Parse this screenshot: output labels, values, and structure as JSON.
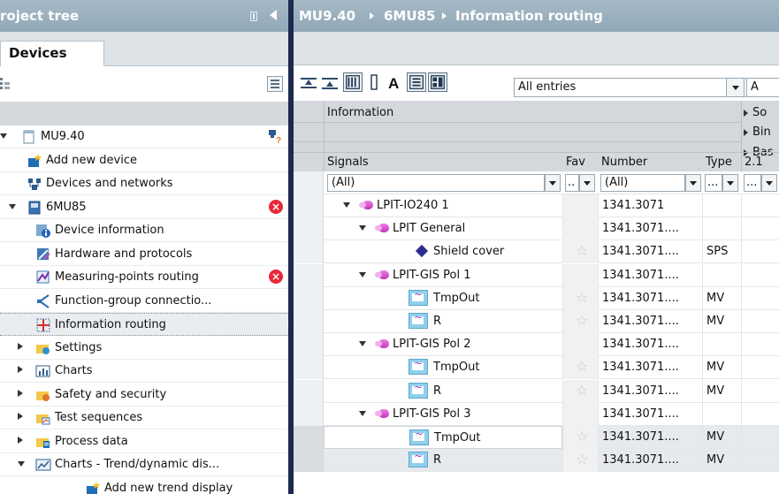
{
  "left_pane": {
    "title": "roject tree",
    "tab": "Devices",
    "tree": [
      {
        "label": "MU9.40",
        "indent": 0,
        "expand": "down",
        "icon": "page-icon",
        "right": "online"
      },
      {
        "label": "Add new device",
        "indent": 1,
        "expand": "none",
        "icon": "add-device-icon"
      },
      {
        "label": "Devices and networks",
        "indent": 1,
        "expand": "none",
        "icon": "network-icon"
      },
      {
        "label": "6MU85",
        "indent": 1,
        "expand": "down",
        "icon": "device-icon",
        "right": "error"
      },
      {
        "label": "Device information",
        "indent": 2,
        "expand": "none",
        "icon": "info-icon"
      },
      {
        "label": "Hardware and protocols",
        "indent": 2,
        "expand": "none",
        "icon": "hardware-icon"
      },
      {
        "label": "Measuring-points routing",
        "indent": 2,
        "expand": "none",
        "icon": "measuring-icon",
        "right": "error"
      },
      {
        "label": "Function-group connectio...",
        "indent": 2,
        "expand": "none",
        "icon": "connection-icon"
      },
      {
        "label": "Information routing",
        "indent": 2,
        "expand": "none",
        "icon": "routing-icon",
        "selected": true
      },
      {
        "label": "Settings",
        "indent": 2,
        "expand": "right",
        "icon": "settings-folder-icon"
      },
      {
        "label": "Charts",
        "indent": 2,
        "expand": "right",
        "icon": "charts-icon"
      },
      {
        "label": "Safety and security",
        "indent": 2,
        "expand": "right",
        "icon": "safety-folder-icon"
      },
      {
        "label": "Test sequences",
        "indent": 2,
        "expand": "right",
        "icon": "test-folder-icon"
      },
      {
        "label": "Process data",
        "indent": 2,
        "expand": "right",
        "icon": "process-folder-icon"
      },
      {
        "label": "Charts - Trend/dynamic dis...",
        "indent": 2,
        "expand": "down",
        "icon": "trend-chart-icon"
      },
      {
        "label": "Add new trend display",
        "indent": 3,
        "expand": "none",
        "icon": "add-trend-icon"
      }
    ]
  },
  "breadcrumb": [
    "MU9.40",
    "6MU85",
    "Information routing"
  ],
  "toolbar": {
    "filter_value": "All entries",
    "second_value": "A"
  },
  "grid_header": {
    "information": "Information",
    "so": "So",
    "bin": "Bin",
    "bas": "Bas",
    "signals": "Signals",
    "fav": "Fav",
    "number": "Number",
    "type": "Type",
    "extra": "2.1"
  },
  "filter_row": {
    "signals": "(All)",
    "fav": "..",
    "number": "(All)",
    "type": "...",
    "extra": "..."
  },
  "rows": [
    {
      "name": "LPIT-IO240 1",
      "number": "1341.3071",
      "type": "",
      "level": 0,
      "kind": "group",
      "expand": true
    },
    {
      "name": "LPIT General",
      "number": "1341.3071....",
      "type": "",
      "level": 1,
      "kind": "group",
      "expand": true
    },
    {
      "name": "Shield cover",
      "number": "1341.3071....",
      "type": "SPS",
      "level": 2,
      "kind": "sps"
    },
    {
      "name": "LPIT-GIS Pol 1",
      "number": "1341.3071....",
      "type": "",
      "level": 1,
      "kind": "group",
      "expand": true
    },
    {
      "name": "TmpOut",
      "number": "1341.3071....",
      "type": "MV",
      "level": 2,
      "kind": "mv"
    },
    {
      "name": "R",
      "number": "1341.3071....",
      "type": "MV",
      "level": 2,
      "kind": "mv"
    },
    {
      "name": "LPIT-GIS Pol 2",
      "number": "1341.3071....",
      "type": "",
      "level": 1,
      "kind": "group",
      "expand": true
    },
    {
      "name": "TmpOut",
      "number": "1341.3071....",
      "type": "MV",
      "level": 2,
      "kind": "mv"
    },
    {
      "name": "R",
      "number": "1341.3071....",
      "type": "MV",
      "level": 2,
      "kind": "mv"
    },
    {
      "name": "LPIT-GIS Pol 3",
      "number": "1341.3071....",
      "type": "",
      "level": 1,
      "kind": "group",
      "expand": true
    },
    {
      "name": "TmpOut",
      "number": "1341.3071....",
      "type": "MV",
      "level": 2,
      "kind": "mv"
    },
    {
      "name": "R",
      "number": "1341.3071....",
      "type": "MV",
      "level": 2,
      "kind": "mv"
    }
  ],
  "colors": {
    "title_bar": "#9fb3c1",
    "divider": "#1d2a4e",
    "error": "#e8283a",
    "group_icon": "#d64fd0"
  }
}
